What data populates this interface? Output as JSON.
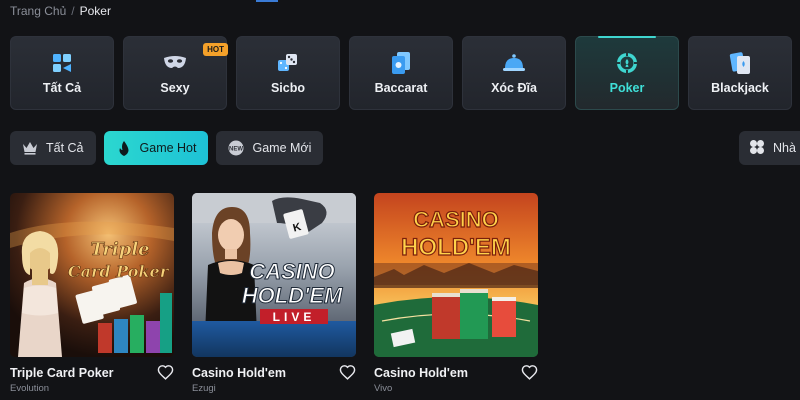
{
  "breadcrumb": {
    "home": "Trang Chủ",
    "separator": "/",
    "current": "Poker"
  },
  "categories": [
    {
      "label": "Tất Cả",
      "icon": "grid-arrows-icon",
      "active": false
    },
    {
      "label": "Sexy",
      "icon": "mask-icon",
      "badge": "HOT",
      "active": false
    },
    {
      "label": "Sicbo",
      "icon": "dice-icon",
      "active": false
    },
    {
      "label": "Baccarat",
      "icon": "card-icon",
      "active": false
    },
    {
      "label": "Xóc Đĩa",
      "icon": "cloche-icon",
      "active": false
    },
    {
      "label": "Poker",
      "icon": "poker-chip-icon",
      "active": true
    },
    {
      "label": "Blackjack",
      "icon": "blackjack-cards-icon",
      "active": false
    }
  ],
  "filters": [
    {
      "label": "Tất Cả",
      "icon": "crown-icon",
      "active": false
    },
    {
      "label": "Game Hot",
      "icon": "flame-icon",
      "active": true
    },
    {
      "label": "Game Mới",
      "icon": "new-icon",
      "active": false
    }
  ],
  "provider_filter": {
    "label": "Nhà",
    "icon": "four-petal-icon"
  },
  "games": [
    {
      "title": "Triple Card Poker",
      "provider": "Evolution",
      "art_text": [
        "Triple",
        "Card Poker"
      ]
    },
    {
      "title": "Casino Hold'em",
      "provider": "Ezugi",
      "art_text": [
        "CASINO",
        "HOLD'EM",
        "LIVE"
      ]
    },
    {
      "title": "Casino Hold'em",
      "provider": "Vivo",
      "art_text": [
        "CASINO",
        "HOLD'EM"
      ]
    }
  ],
  "colors": {
    "accent": "#3fd6d0",
    "hot_badge": "#f4a12a",
    "background": "#121316"
  }
}
